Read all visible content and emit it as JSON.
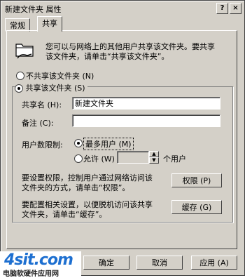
{
  "window": {
    "title": "新建文件夹 属性",
    "help_glyph": "?",
    "close_glyph": "×"
  },
  "tabs": [
    {
      "label": "常规"
    },
    {
      "label": "共享"
    }
  ],
  "intro_text_line1": "您可以与网络上的其他用户共享该文件夹。要共享",
  "intro_text_line2": "该文件夹，请单击“共享该文件夹”。",
  "no_share_label": "不共享该文件夹 (N)",
  "share_label": "共享该文件夹 (S)",
  "share_name": {
    "label": "共享名 (H):",
    "value": "新建文件夹"
  },
  "comment": {
    "label": "备注 (C):",
    "value": ""
  },
  "user_limit": {
    "label": "用户数限制:",
    "max_label": "最多用户 (M)",
    "allow_label": "允许 (W)",
    "allow_value": "",
    "unit": "个用户"
  },
  "permissions": {
    "text_line1": "要设置权限，控制用户通过网络访问该",
    "text_line2": "文件夹的方式，请单击“权限”。",
    "button": "权限 (P)"
  },
  "caching": {
    "text_line1": "要配置相关设置，以便脱机访问该共享",
    "text_line2": "文件夹，请单击“缓存”。",
    "button": "缓存 (G)"
  },
  "footer": {
    "ok": "确定",
    "cancel": "取消",
    "apply": "应用 (A)"
  },
  "watermark": {
    "logo": "4sit.com",
    "caption": "电脑软硬件应用网"
  }
}
